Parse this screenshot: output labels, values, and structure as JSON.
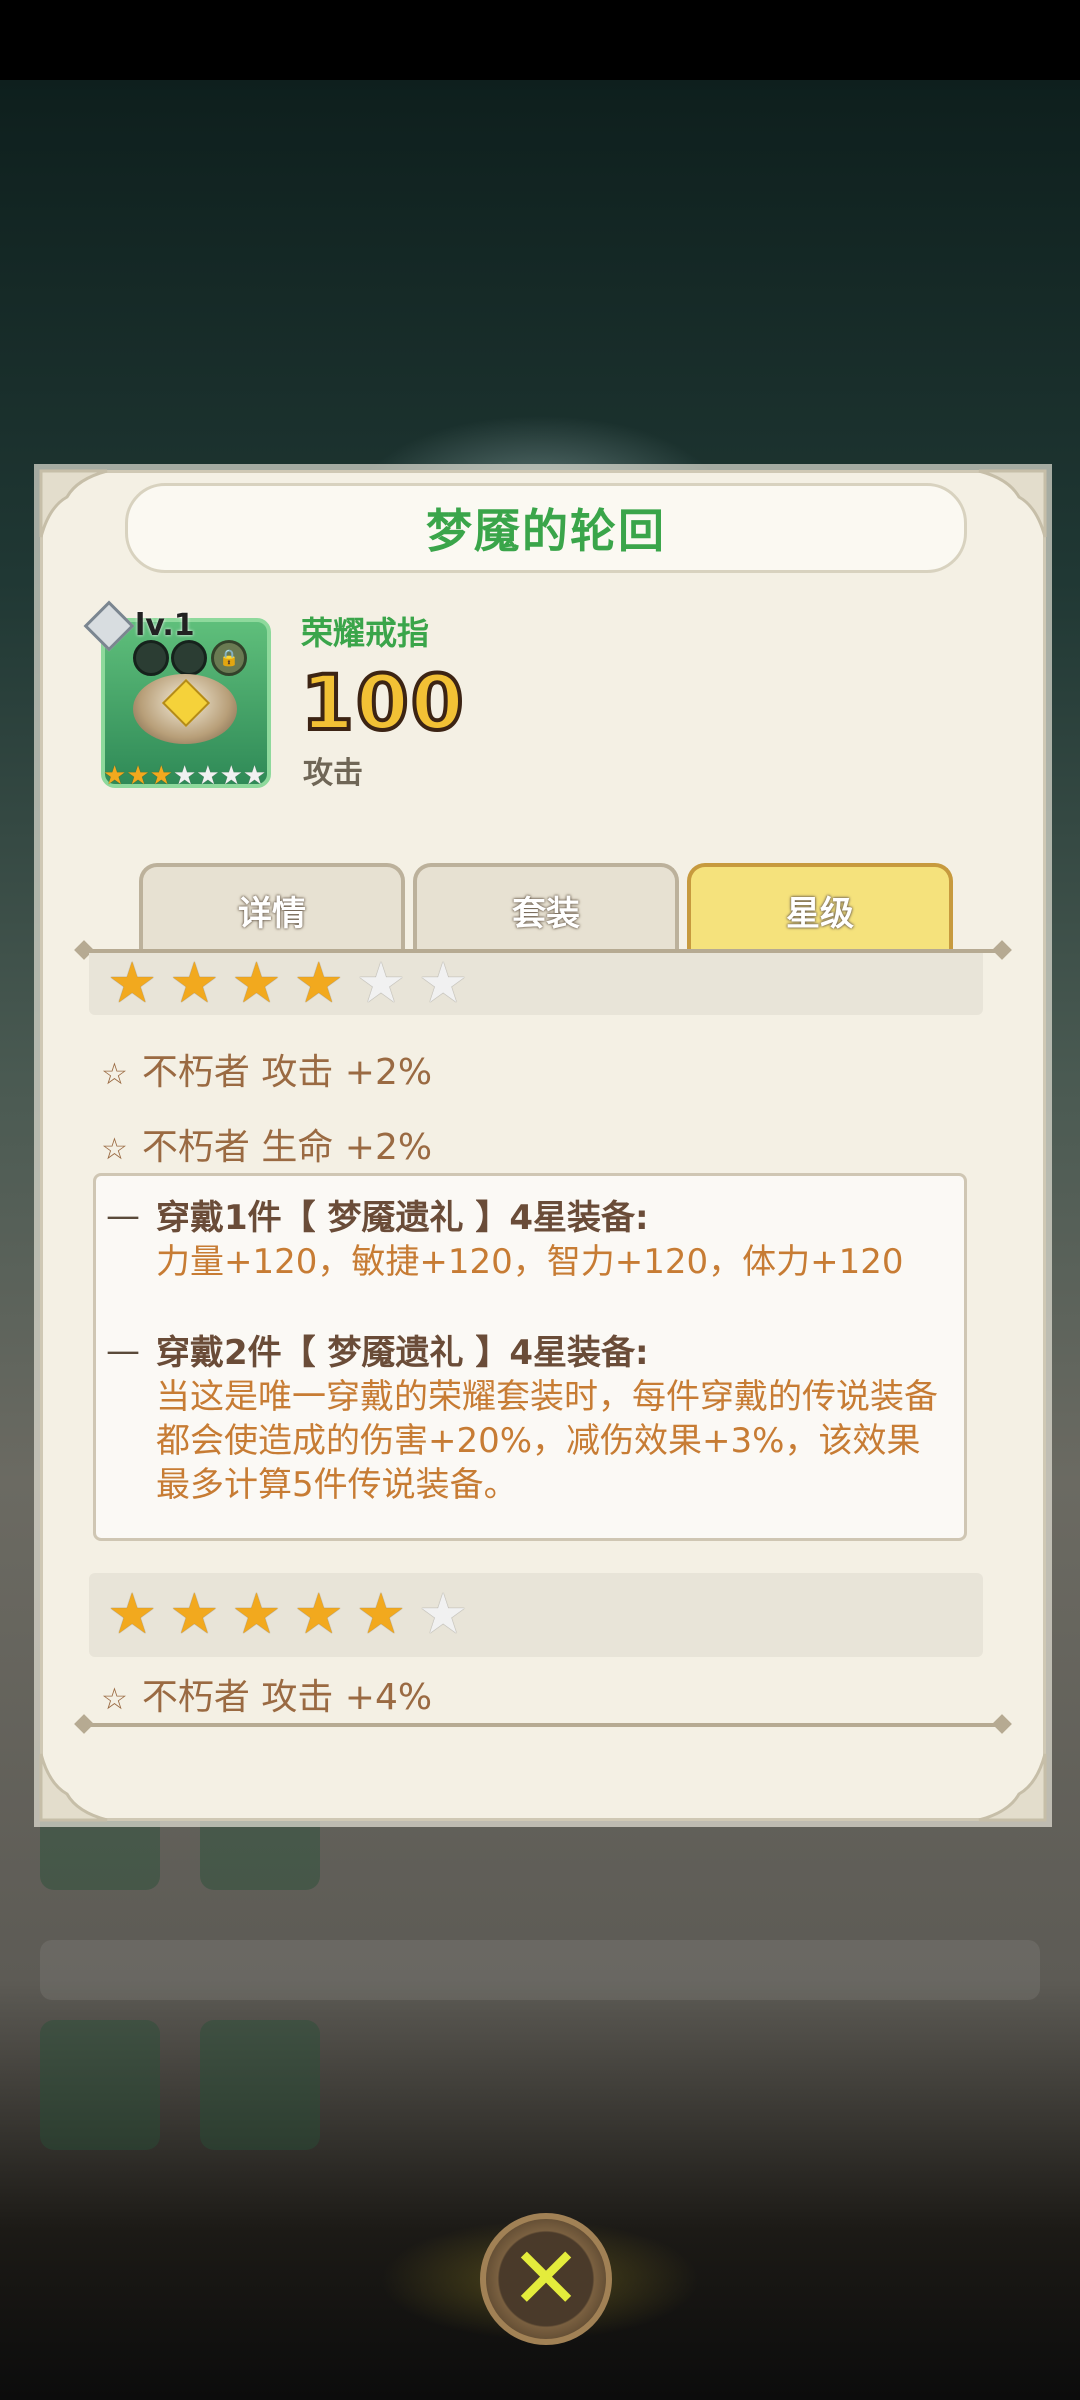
{
  "dialog": {
    "title": "梦魇的轮回"
  },
  "item": {
    "name": "荣耀戒指",
    "level": "lv.1",
    "attack_value": "100",
    "attack_label": "攻击",
    "stars": {
      "filled": 3,
      "total": 7
    },
    "icon": "ring-icon"
  },
  "tabs": [
    {
      "label": "详情",
      "active": false
    },
    {
      "label": "套装",
      "active": false
    },
    {
      "label": "星级",
      "active": true
    }
  ],
  "tiers": [
    {
      "stars_filled": 4,
      "stars_total": 6,
      "bonuses": [
        "不朽者 攻击 +2%",
        "不朽者 生命 +2%"
      ]
    },
    {
      "stars_filled": 5,
      "stars_total": 6,
      "bonuses": [
        "不朽者 攻击 +4%"
      ]
    }
  ],
  "set_box": {
    "entries": [
      {
        "heading": "穿戴1件【 梦魇遗礼 】4星装备:",
        "body": "力量+120，敏捷+120，智力+120，体力+120"
      },
      {
        "heading": "穿戴2件【 梦魇遗礼 】4星装备:",
        "body": "当这是唯一穿戴的荣耀套装时，每件穿戴的传说装备都会使造成的伤害+20%，减伤效果+3%，该效果最多计算5件传说装备。"
      }
    ]
  },
  "colors": {
    "title_green": "#3aa54a",
    "bonus_brown": "#9a6a42",
    "set_body_orange": "#c77c34",
    "tab_active": "#f5e27c"
  },
  "close_icon": "close-x-icon"
}
